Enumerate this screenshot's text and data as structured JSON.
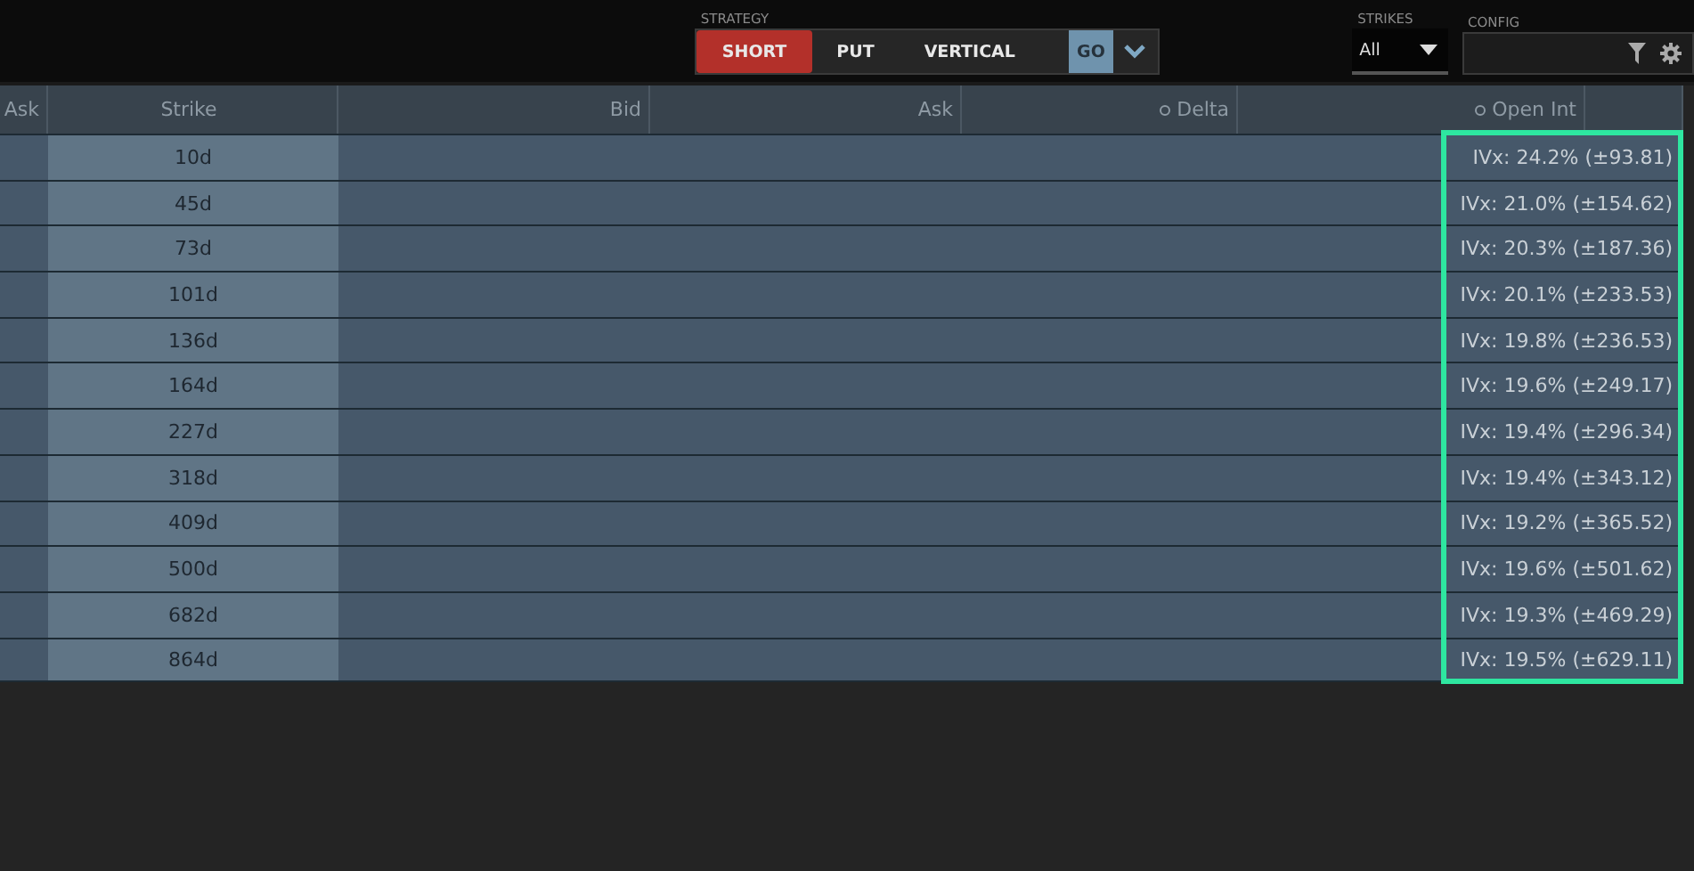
{
  "toolbar": {
    "strategy_label": "STRATEGY",
    "strategy_buttons": [
      {
        "label": "SHORT",
        "selected": true
      },
      {
        "label": "PUT",
        "selected": false
      },
      {
        "label": "VERTICAL",
        "selected": false
      }
    ],
    "go_button": "GO",
    "strikes": {
      "label": "STRIKES",
      "value": "All"
    },
    "config": {
      "label": "CONFIG"
    }
  },
  "table": {
    "columns": [
      {
        "label": "Ask",
        "dot": false
      },
      {
        "label": "Strike",
        "dot": false
      },
      {
        "label": "Bid",
        "dot": false
      },
      {
        "label": "Ask",
        "dot": false
      },
      {
        "label": "Delta",
        "dot": true
      },
      {
        "label": "Open Int",
        "dot": true
      }
    ],
    "ivx_highlighted": true,
    "rows": [
      {
        "strike": "10d",
        "ivx": "IVx: 24.2% (±93.81)"
      },
      {
        "strike": "45d",
        "ivx": "IVx: 21.0% (±154.62)"
      },
      {
        "strike": "73d",
        "ivx": "IVx: 20.3% (±187.36)"
      },
      {
        "strike": "101d",
        "ivx": "IVx: 20.1% (±233.53)"
      },
      {
        "strike": "136d",
        "ivx": "IVx: 19.8% (±236.53)"
      },
      {
        "strike": "164d",
        "ivx": "IVx: 19.6% (±249.17)"
      },
      {
        "strike": "227d",
        "ivx": "IVx: 19.4% (±296.34)"
      },
      {
        "strike": "318d",
        "ivx": "IVx: 19.4% (±343.12)"
      },
      {
        "strike": "409d",
        "ivx": "IVx: 19.2% (±365.52)"
      },
      {
        "strike": "500d",
        "ivx": "IVx: 19.6% (±501.62)"
      },
      {
        "strike": "682d",
        "ivx": "IVx: 19.3% (±469.29)"
      },
      {
        "strike": "864d",
        "ivx": "IVx: 19.5% (±629.11)"
      }
    ]
  }
}
